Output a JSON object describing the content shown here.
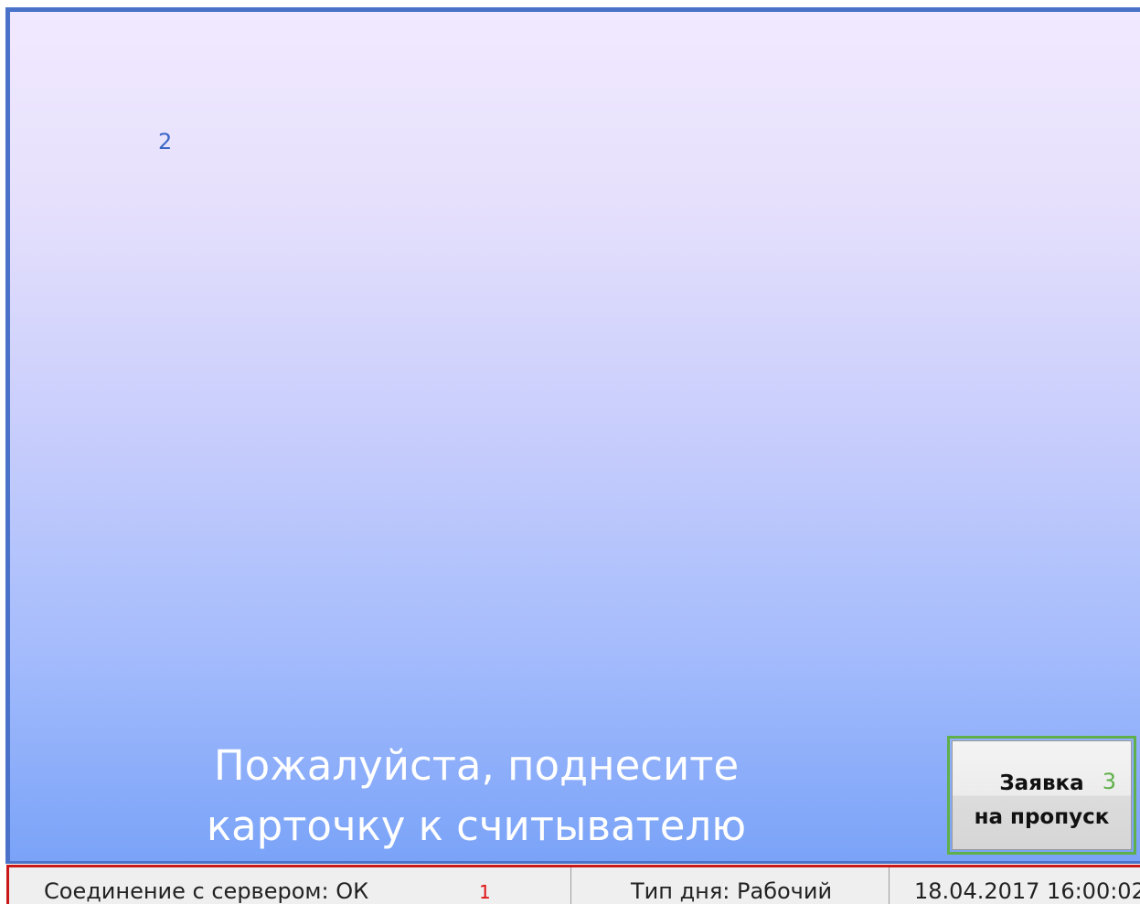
{
  "main": {
    "marker": "2",
    "prompt_line1": "Пожалуйста, поднесите",
    "prompt_line2": "карточку к считывателю",
    "gradient_top": "#f1e9ff",
    "gradient_bottom": "#7aa3f8"
  },
  "request_button": {
    "line1": "Заявка",
    "line2": "на пропуск",
    "marker": "3"
  },
  "status_bar": {
    "connection": "Соединение с сервером: ОК",
    "marker": "1",
    "day_type": "Тип дня: Рабочий",
    "datetime": "18.04.2017 16:00:02"
  },
  "colors": {
    "annotation_blue": "#4a72c9",
    "annotation_green": "#5fb04a",
    "annotation_red": "#c81818"
  }
}
